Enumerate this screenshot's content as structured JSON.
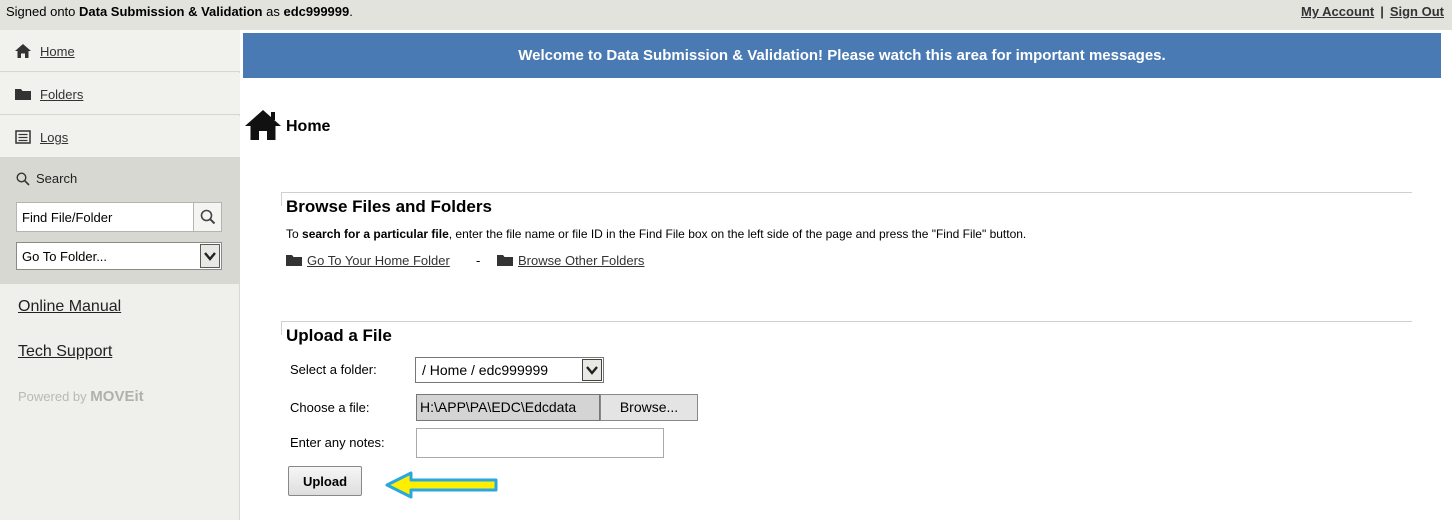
{
  "topbar": {
    "signed_prefix": "Signed onto ",
    "app_name": "Data Submission & Validation",
    "signed_mid": " as ",
    "username": "edc999999",
    "signed_suffix": ".",
    "my_account": "My Account",
    "separator": "|",
    "sign_out": "Sign Out"
  },
  "sidebar": {
    "nav": [
      {
        "label": "Home",
        "icon": "home-icon"
      },
      {
        "label": "Folders",
        "icon": "folder-icon"
      },
      {
        "label": "Logs",
        "icon": "log-icon"
      }
    ],
    "search": {
      "label": "Search",
      "find_value": "Find File/Folder",
      "goto_value": "Go To Folder..."
    },
    "online_manual": "Online Manual",
    "tech_support": "Tech Support",
    "powered_by": "Powered by",
    "brand": "MOVEit"
  },
  "main": {
    "welcome": "Welcome to Data Submission & Validation! Please watch this area for important messages.",
    "page_title": "Home",
    "browse": {
      "title": "Browse Files and Folders",
      "desc_prefix": "To ",
      "desc_bold": "search for a particular file",
      "desc_suffix": ", enter the file name or file ID in the Find File box on the left side of the page and press the \"Find File\" button.",
      "home_folder_link": "Go To Your Home Folder",
      "dash": "-",
      "other_folders_link": "Browse Other Folders"
    },
    "upload": {
      "title": "Upload a File",
      "select_folder_label": "Select a folder:",
      "folder_value": "/ Home / edc999999",
      "choose_file_label": "Choose a file:",
      "file_value": "H:\\APP\\PA\\EDC\\Edcdata",
      "browse_label": "Browse...",
      "notes_label": "Enter any notes:",
      "notes_value": "",
      "upload_label": "Upload"
    }
  },
  "colors": {
    "welcome_bg": "#4a7ab4",
    "arrow_fill": "#ffee00",
    "arrow_stroke": "#29a8e0"
  }
}
